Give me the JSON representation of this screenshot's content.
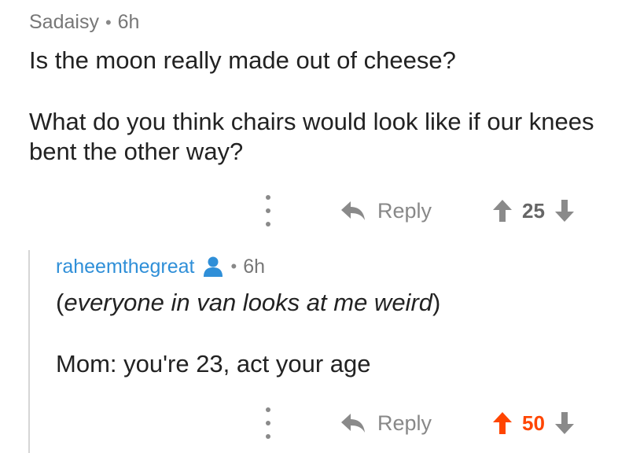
{
  "comments": [
    {
      "author": "Sadaisy",
      "separator": "•",
      "age": "6h",
      "body_line1": "Is the moon really made out of cheese?",
      "body_line2": "What do you think chairs would look like if our knees bent the other way?",
      "reply_label": "Reply",
      "score": "25",
      "upvoted": false
    },
    {
      "author": "raheemthegreat",
      "separator": "•",
      "age": "6h",
      "body_line1_open": "(",
      "body_line1_italic": "everyone in van looks at me weird",
      "body_line1_close": ")",
      "body_line2": "Mom: you're 23, act your age",
      "reply_label": "Reply",
      "score": "50",
      "upvoted": true
    }
  ],
  "icons": {
    "more": "more-vertical-icon",
    "reply": "reply-icon",
    "upvote": "upvote-arrow-icon",
    "downvote": "downvote-arrow-icon",
    "user": "user-icon"
  },
  "colors": {
    "upvote_active": "#ff4500",
    "vote_inactive": "#8a8a8a",
    "username_link": "#2f8fd8"
  }
}
